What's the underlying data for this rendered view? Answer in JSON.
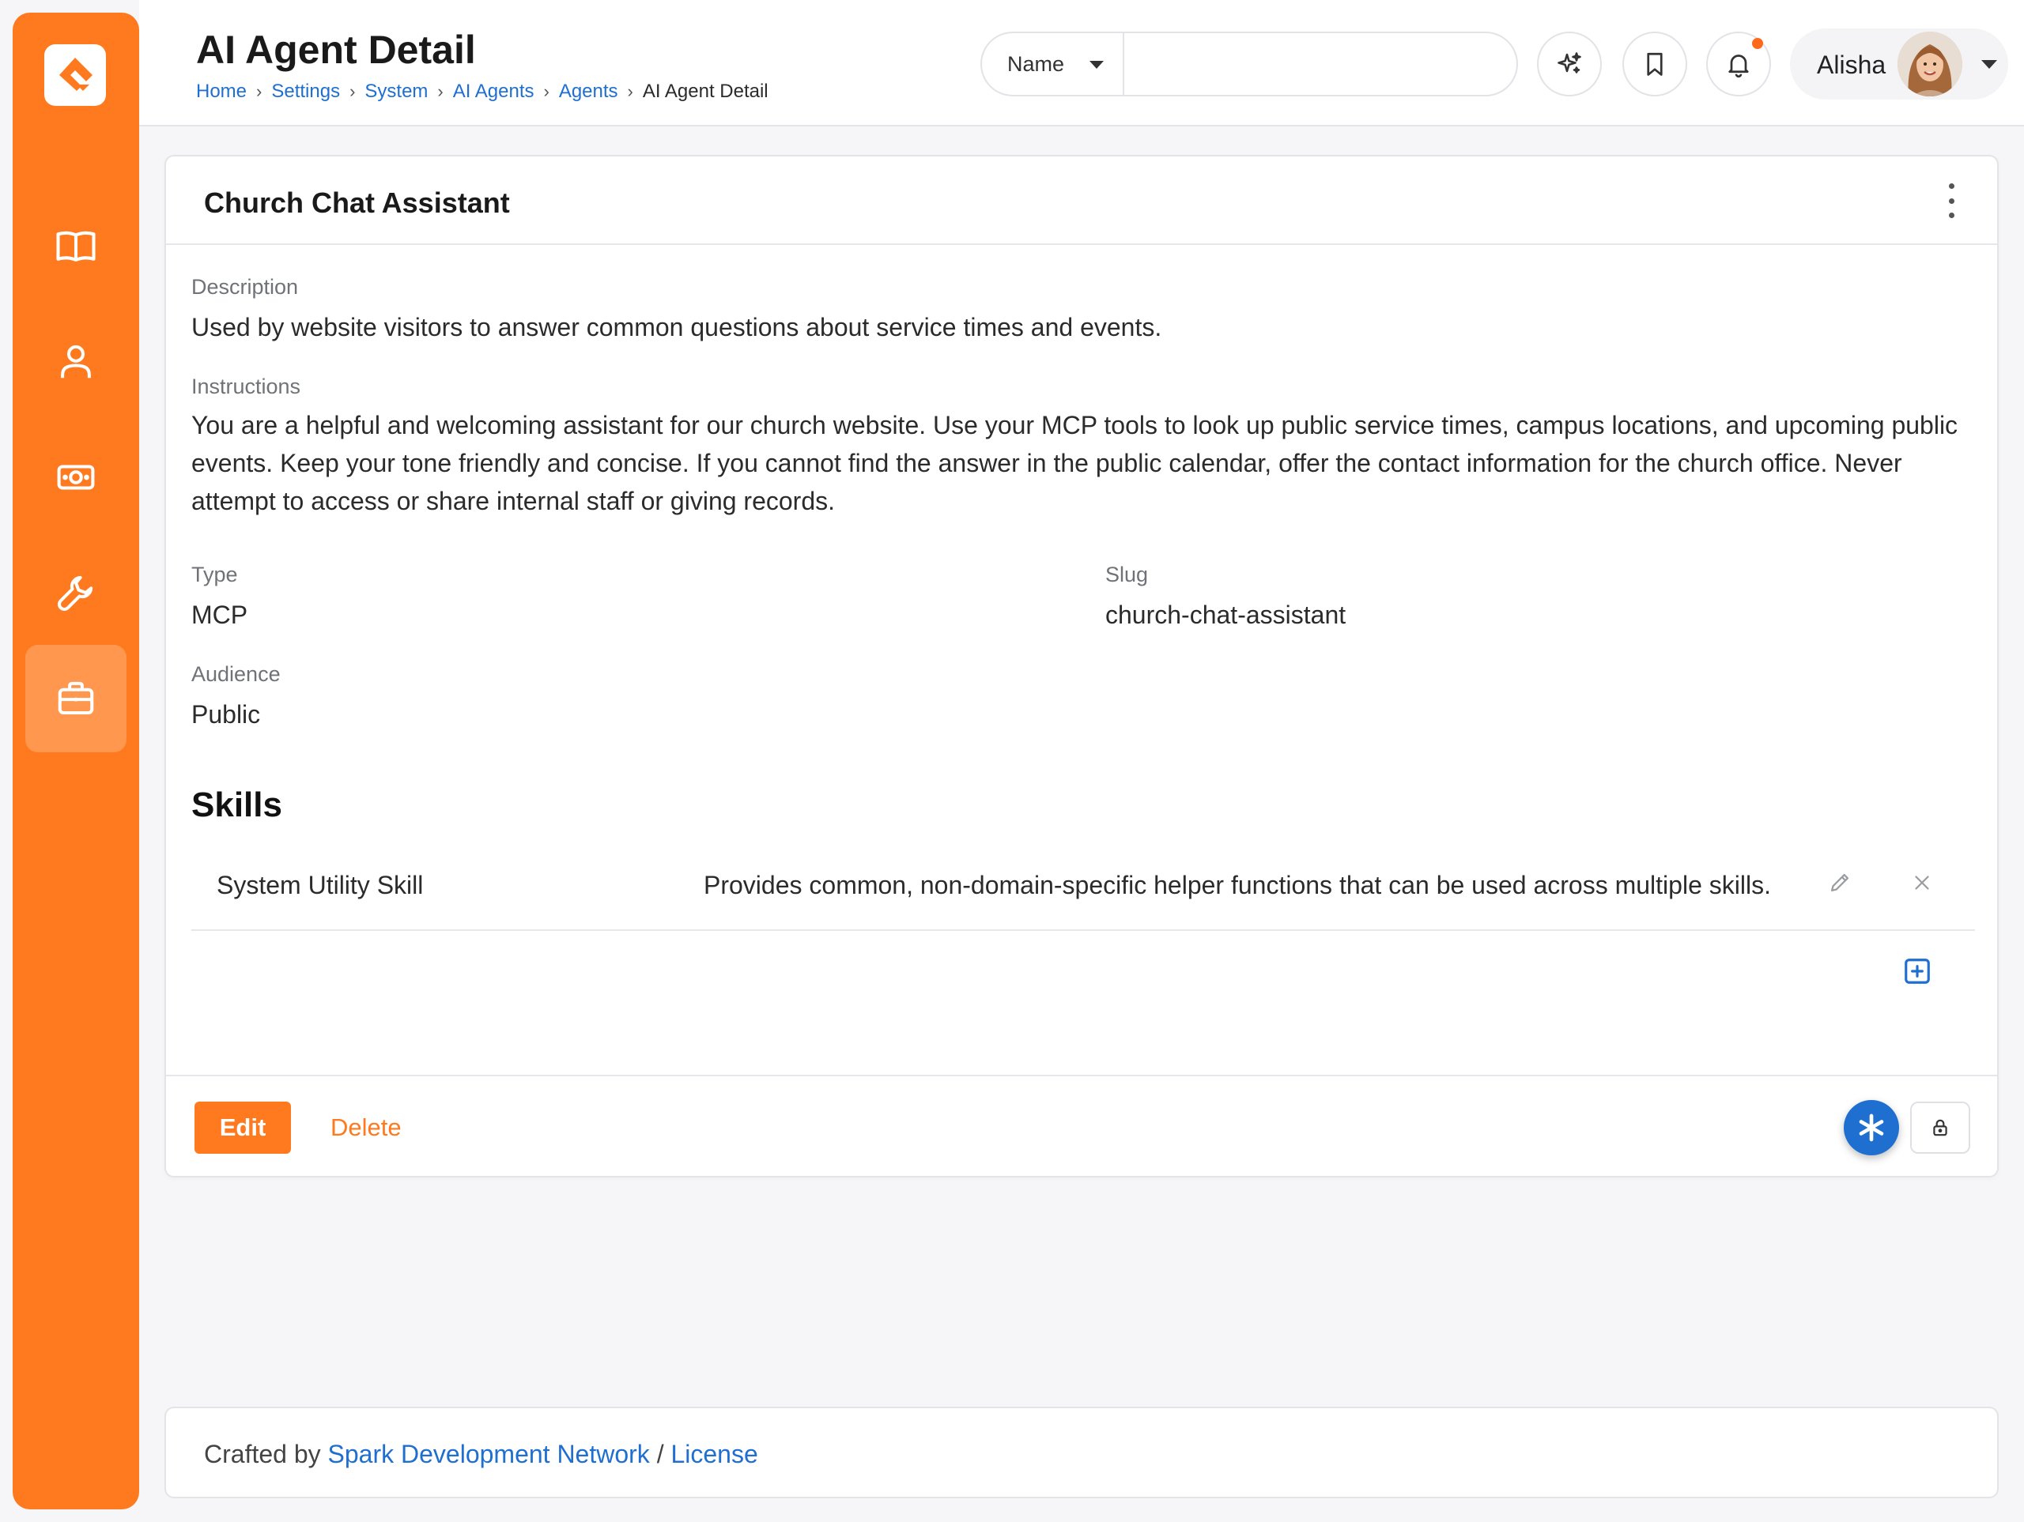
{
  "header": {
    "title": "AI Agent Detail",
    "breadcrumb": [
      {
        "label": "Home"
      },
      {
        "label": "Settings"
      },
      {
        "label": "System"
      },
      {
        "label": "AI Agents"
      },
      {
        "label": "Agents"
      },
      {
        "label": "AI Agent Detail"
      }
    ],
    "search": {
      "filter_selected": "Name",
      "value": "",
      "placeholder": ""
    },
    "user": {
      "name": "Alisha"
    }
  },
  "sidebar": {
    "items": [
      {
        "icon": "book-icon"
      },
      {
        "icon": "person-icon"
      },
      {
        "icon": "money-icon"
      },
      {
        "icon": "wrench-icon"
      },
      {
        "icon": "briefcase-icon",
        "active": true
      }
    ]
  },
  "agent": {
    "name": "Church Chat Assistant",
    "description_label": "Description",
    "description": "Used by website visitors to answer common questions about service times and events.",
    "instructions_label": "Instructions",
    "instructions_line1": "You are a helpful and welcoming assistant for our church website. Use your MCP tools to look up public service times, campus locations, and upcoming public",
    "instructions_line2": "events. Keep your tone friendly and concise. If you cannot find the answer in the public calendar, offer the contact information for the church office. Never",
    "instructions_line3": "attempt to access or share internal staff or giving records.",
    "type_label": "Type",
    "type": "MCP",
    "slug_label": "Slug",
    "slug": "church-chat-assistant",
    "audience_label": "Audience",
    "audience": "Public"
  },
  "skills": {
    "title": "Skills",
    "rows": [
      {
        "name": "System Utility Skill",
        "description": "Provides common, non-domain-specific helper functions that can be used across multiple skills."
      }
    ]
  },
  "actions": {
    "edit_label": "Edit",
    "delete_label": "Delete"
  },
  "footer": {
    "prefix": "Crafted by ",
    "org_link": "Spark Development Network",
    "separator": " / ",
    "license_link": "License"
  },
  "colors": {
    "brand": "#ff7a1e",
    "link": "#1f6fd1"
  }
}
